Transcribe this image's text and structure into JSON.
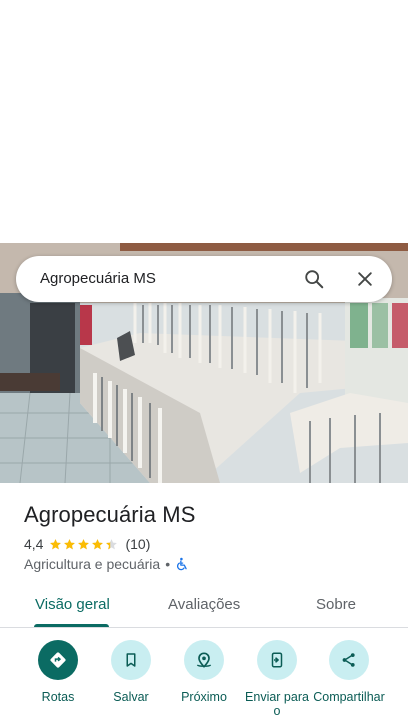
{
  "search": {
    "query": "Agropecuária MS"
  },
  "place": {
    "name": "Agropecuária MS",
    "rating": "4,4",
    "rating_value": 4.4,
    "review_count": "(10)",
    "category": "Agricultura e pecuária",
    "separator": "•"
  },
  "tabs": [
    {
      "label": "Visão geral",
      "active": true
    },
    {
      "label": "Avaliações",
      "active": false
    },
    {
      "label": "Sobre",
      "active": false
    }
  ],
  "actions": [
    {
      "label": "Rotas",
      "icon": "directions-icon"
    },
    {
      "label": "Salvar",
      "icon": "bookmark-icon"
    },
    {
      "label": "Próximo",
      "icon": "nearby-icon"
    },
    {
      "label": "Enviar para o",
      "icon": "send-to-phone-icon"
    },
    {
      "label": "Compartilhar",
      "icon": "share-icon"
    }
  ],
  "colors": {
    "accent": "#0b6b63",
    "action_bg": "#c9eef1",
    "star": "#fbbc04",
    "accessibility": "#1a73e8"
  }
}
